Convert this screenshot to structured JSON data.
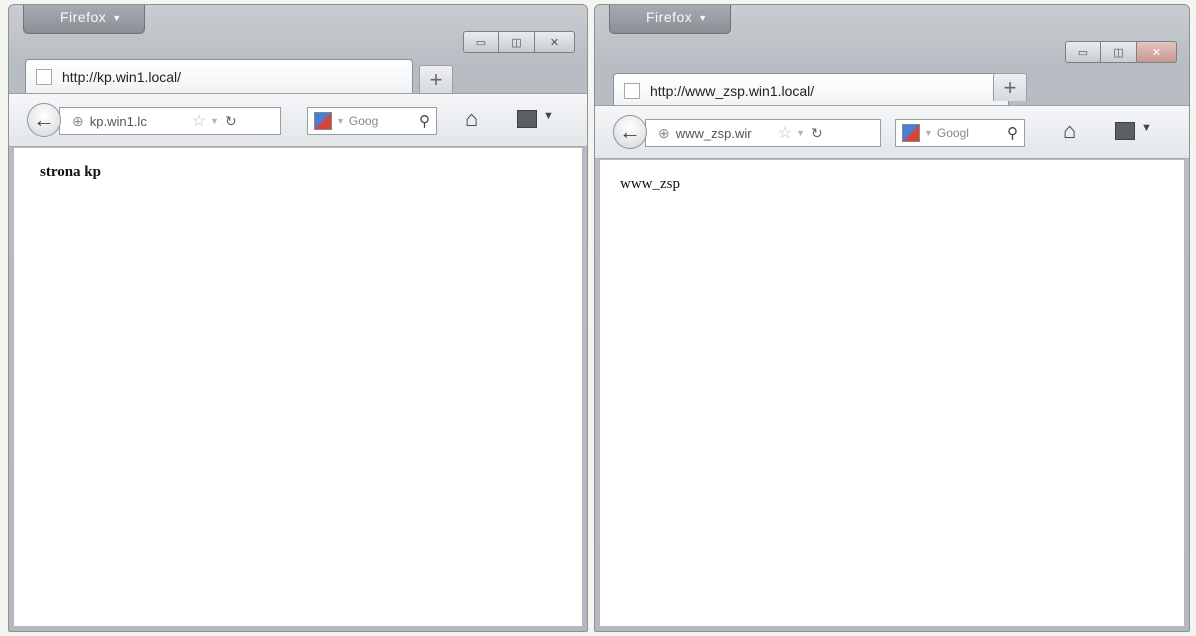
{
  "windows": [
    {
      "app_button": "Firefox",
      "tab_title": "http://kp.win1.local/",
      "url_display": "kp.win1.lc",
      "search_text": "Goog",
      "page_text": "strona kp"
    },
    {
      "app_button": "Firefox",
      "tab_title": "http://www_zsp.win1.local/",
      "url_display": "www_zsp.wir",
      "search_text": "Googl",
      "page_text": "www_zsp"
    }
  ],
  "icons": {
    "back": "arrow-left",
    "site": "globe",
    "bookmark_star": "star",
    "reload": "reload",
    "search": "magnifier",
    "home": "house",
    "bookmarks": "bookmarks-menu",
    "new_tab": "plus",
    "minimize": "minimize",
    "maximize": "maximize",
    "close": "close"
  },
  "colors": {
    "chrome": "#b8bdc3",
    "page_background": "#ffffff",
    "close_hover": "#c79790"
  }
}
